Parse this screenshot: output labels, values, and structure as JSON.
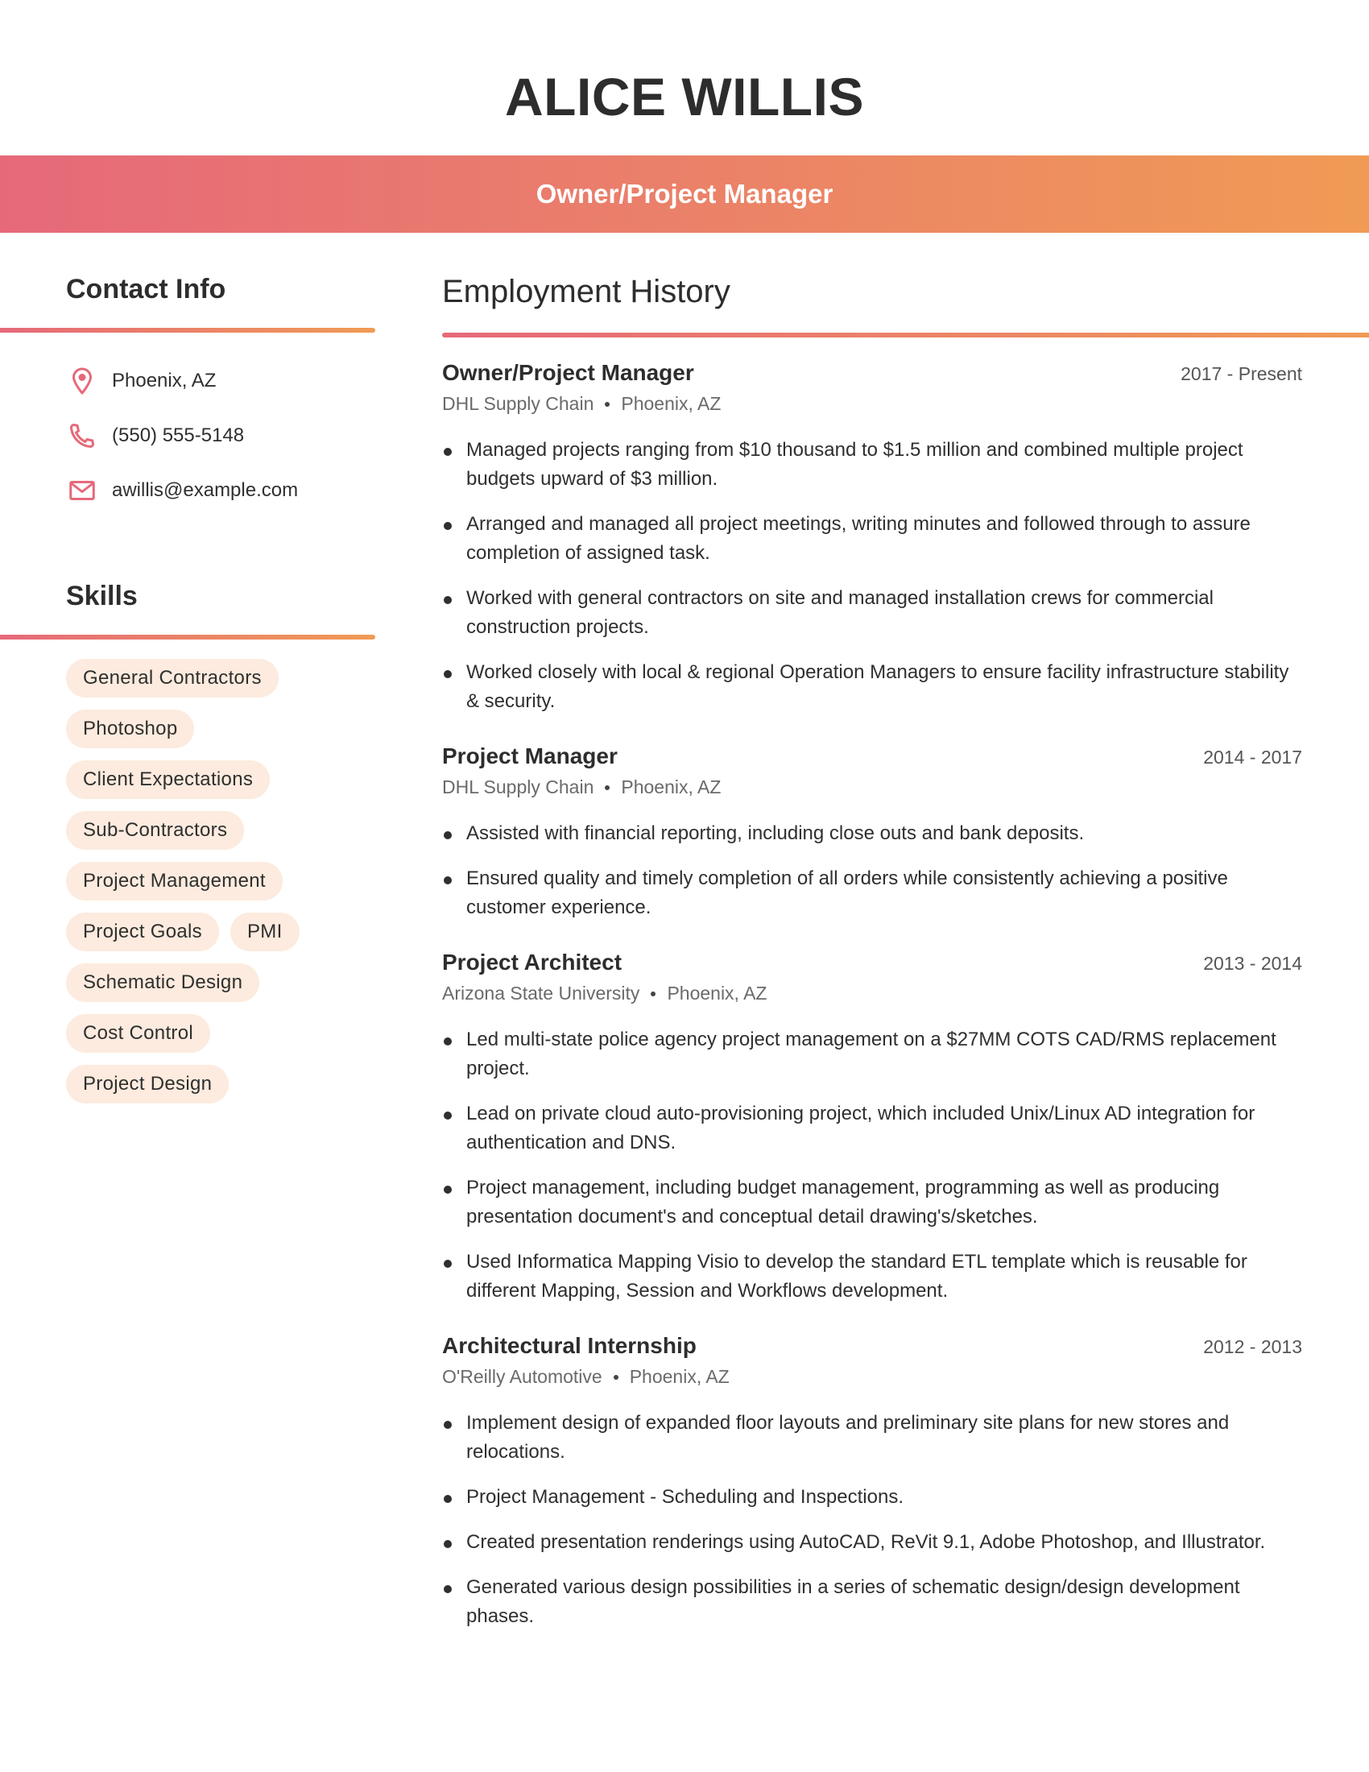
{
  "header": {
    "name": "ALICE WILLIS",
    "title": "Owner/Project Manager"
  },
  "colors": {
    "gradient_start": "#e6697a",
    "gradient_end": "#f09b55",
    "pill_bg": "#fcebde",
    "icon": "#e6697a",
    "text": "#2f2f2f"
  },
  "contact": {
    "heading": "Contact Info",
    "items": [
      {
        "icon": "location-pin-icon",
        "text": "Phoenix, AZ"
      },
      {
        "icon": "phone-icon",
        "text": "(550) 555-5148"
      },
      {
        "icon": "email-icon",
        "text": "awillis@example.com"
      }
    ]
  },
  "skills": {
    "heading": "Skills",
    "items": [
      "General Contractors",
      "Photoshop",
      "Client Expectations",
      "Sub-Contractors",
      "Project Management",
      "Project Goals",
      "PMI",
      "Schematic Design",
      "Cost Control",
      "Project Design"
    ]
  },
  "employment": {
    "heading": "Employment History",
    "jobs": [
      {
        "title": "Owner/Project Manager",
        "dates": "2017 - Present",
        "company": "DHL Supply Chain",
        "location": "Phoenix, AZ",
        "bullets": [
          "Managed projects ranging from $10 thousand to $1.5 million and combined multiple project budgets upward of $3 million.",
          "Arranged and managed all project meetings, writing minutes and followed through to assure completion of assigned task.",
          "Worked with general contractors on site and managed installation crews for commercial construction projects.",
          "Worked closely with local & regional Operation Managers to ensure facility infrastructure stability & security."
        ]
      },
      {
        "title": "Project Manager",
        "dates": "2014 - 2017",
        "company": "DHL Supply Chain",
        "location": "Phoenix, AZ",
        "bullets": [
          "Assisted with financial reporting, including close outs and bank deposits.",
          "Ensured quality and timely completion of all orders while consistently achieving a positive customer experience."
        ]
      },
      {
        "title": "Project Architect",
        "dates": "2013 - 2014",
        "company": "Arizona State University",
        "location": "Phoenix, AZ",
        "bullets": [
          "Led multi-state police agency project management on a $27MM COTS CAD/RMS replacement project.",
          "Lead on private cloud auto-provisioning project, which included Unix/Linux AD integration for authentication and DNS.",
          "Project management, including budget management, programming as well as producing presentation document's and conceptual detail drawing's/sketches.",
          "Used Informatica Mapping Visio to develop the standard ETL template which is reusable for different Mapping, Session and Workflows development."
        ]
      },
      {
        "title": "Architectural Internship",
        "dates": "2012 - 2013",
        "company": "O'Reilly Automotive",
        "location": "Phoenix, AZ",
        "bullets": [
          "Implement design of expanded floor layouts and preliminary site plans for new stores and relocations.",
          "Project Management - Scheduling and Inspections.",
          "Created presentation renderings using AutoCAD, ReVit 9.1, Adobe Photoshop, and Illustrator.",
          "Generated various design possibilities in a series of schematic design/design development phases."
        ]
      }
    ]
  }
}
